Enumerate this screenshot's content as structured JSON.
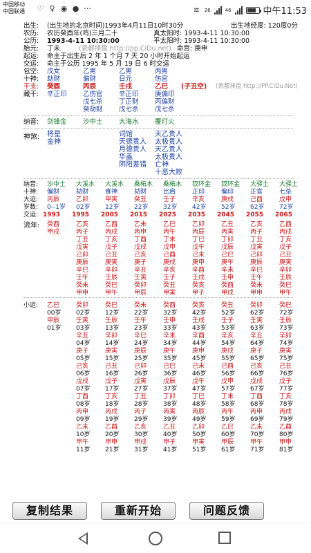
{
  "status": {
    "carrier1": "中国移动",
    "carrier2": "中国联通",
    "icons": [
      "shield-check-icon",
      "location-icon",
      "q-app-icon",
      "chat-icon",
      "more-icon"
    ],
    "network": "26",
    "network2": "46",
    "time": "中午11:53"
  },
  "header": {
    "birth_label": "出生:",
    "birth_value": "(出生地的北京时间)1993年4月11日10时30分",
    "longitude": "出生地经度: 120度0分",
    "lunar_label": "农历:",
    "lunar_value": "农历癸酉年(鸡)三月二十",
    "true_sun": "真太阳时: 1993-4-11 10:30:00",
    "gongli_label": "公历:",
    "gongli_value": "1993-4-11 10:30:00",
    "avg_sun": "平太阳时: 1993-4-11 10:30:00",
    "taiyuan_label": "胎元:",
    "taiyuan_value": "丁未",
    "watermark": "(瓷都排盘 http://pp.CiDu.net)",
    "minggong": "命宫: 庚申",
    "qiyun_label": "起运:",
    "qiyun_value": "命主于出生后 2 年 1 个月 7 天 20 小时开始起运",
    "jiaoyun_label": "交运:",
    "jiaoyun_value": "命主于公历 1995 年 5 月 19 日 6 时交运"
  },
  "pillars": {
    "baozang_label": "包空:",
    "baozang": [
      "戊女",
      "乙男",
      "乙男",
      "丙男"
    ],
    "shishen_label": "十神:",
    "shishen": [
      "劫财",
      "偏财",
      "日元",
      "伤官"
    ],
    "ganzhi_label": "干支:",
    "ganzhi": [
      "癸酉",
      "丙辰",
      "壬戌",
      "乙巳"
    ],
    "kong": "(子丑空)",
    "watermark2": "(瓷都排盘 http://PP.CiDu.Net)",
    "canggan_label": "藏干:",
    "canggan": [
      [
        "辛正印"
      ],
      [
        "乙伤官",
        "戊七杀",
        "癸劫财"
      ],
      [
        "辛正印",
        "丁正财",
        "戊七杀"
      ],
      [
        "庚偏印",
        "丙偏财",
        "戊七杀"
      ]
    ],
    "nayin_label": "纳音:",
    "nayin": [
      "剑锋金",
      "沙中土",
      "大海水",
      "覆灯火"
    ],
    "shensha_label": "神煞:",
    "shensha": [
      [
        "将星",
        "金神"
      ],
      [],
      [
        "词馆",
        "天德贵人",
        "月德贵人",
        "华盖",
        "阴阳差错"
      ],
      [
        "天乙贵人",
        "太极贵人",
        "天乙贵人",
        "太极贵人",
        "亡神",
        "十恶大败"
      ]
    ]
  },
  "dayun": {
    "nayin_label": "纳音:",
    "nayin": [
      "沙中土",
      "大溪水",
      "大溪水",
      "桑柘木",
      "桑柘木",
      "钗环金",
      "钗环金",
      "大驿土",
      "大驿土"
    ],
    "shishen_label": "十神:",
    "shishen": [
      "偏财",
      "劫财",
      "食神",
      "劫财",
      "比肩",
      "正印",
      "偏印",
      "正官",
      "七杀"
    ],
    "dayun_label": "大运:",
    "dayun": [
      "丙辰",
      "乙卯",
      "甲寅",
      "癸丑",
      "壬子",
      "辛亥",
      "庚戌",
      "己酉",
      "戊申"
    ],
    "age_label": "岁数:",
    "ages": [
      "0--1岁",
      "02岁",
      "12岁",
      "22岁",
      "32岁",
      "42岁",
      "52岁",
      "62岁",
      "72岁"
    ],
    "jiaoyun_label": "交运:",
    "years": [
      "1993",
      "1995",
      "2005",
      "2015",
      "2025",
      "2035",
      "2045",
      "2055",
      "2065"
    ],
    "liunian_label": "流年:",
    "liunian": [
      [
        "癸酉",
        "甲戌"
      ],
      [
        "乙亥",
        "丙子",
        "丁丑",
        "戊寅",
        "己卯",
        "庚辰",
        "辛巳",
        "壬午",
        "癸未",
        "甲申"
      ],
      [
        "乙酉",
        "丙戌",
        "丁亥",
        "戊子",
        "己丑",
        "庚寅",
        "辛卯",
        "壬辰",
        "癸巳",
        "甲午"
      ],
      [
        "乙未",
        "丙申",
        "丁酉",
        "戊戌",
        "己亥",
        "庚子",
        "辛丑",
        "壬寅",
        "癸卯",
        "甲辰"
      ],
      [
        "乙巳",
        "丙午",
        "丁未",
        "戊申",
        "己酉",
        "庚戌",
        "辛亥",
        "壬子",
        "癸丑",
        "甲寅"
      ],
      [
        "乙卯",
        "丙辰",
        "丁巳",
        "戊午",
        "己未",
        "庚申",
        "辛酉",
        "壬戌",
        "癸亥",
        "甲子"
      ],
      [
        "乙丑",
        "丙寅",
        "丁卯",
        "戊辰",
        "己巳",
        "庚午",
        "辛未",
        "壬申",
        "癸酉",
        "甲戌"
      ],
      [
        "乙亥",
        "丙子",
        "丁丑",
        "戊寅",
        "己卯",
        "庚辰",
        "辛巳",
        "壬午",
        "癸未",
        "甲申"
      ],
      [
        "乙酉",
        "丙戌",
        "丁亥",
        "戊子",
        "己丑",
        "庚寅",
        "辛卯",
        "壬辰",
        "癸巳",
        "甲午"
      ]
    ]
  },
  "xiaoyun": {
    "label": "小运:",
    "first": [
      "乙巳",
      "00岁",
      "甲辰",
      "01岁"
    ],
    "rows": [
      [
        "癸卯",
        "02岁",
        "壬寅",
        "03岁",
        "辛丑",
        "04岁",
        "庚子",
        "05岁",
        "己亥",
        "06岁",
        "戊戌",
        "07岁",
        "丁酉",
        "08岁",
        "丙申",
        "09岁",
        "乙未",
        "10岁",
        "甲午",
        "11岁"
      ],
      [
        "癸巳",
        "12岁",
        "壬辰",
        "13岁",
        "辛卯",
        "14岁",
        "庚寅",
        "15岁",
        "己丑",
        "16岁",
        "戊子",
        "17岁",
        "丁亥",
        "18岁",
        "丙戌",
        "19岁",
        "乙酉",
        "20岁",
        "甲申",
        "21岁"
      ],
      [
        "癸未",
        "22岁",
        "壬午",
        "23岁",
        "辛巳",
        "24岁",
        "庚辰",
        "25岁",
        "己卯",
        "26岁",
        "戊寅",
        "27岁",
        "丁丑",
        "28岁",
        "丙子",
        "29岁",
        "乙亥",
        "30岁",
        "甲戌",
        "31岁"
      ],
      [
        "癸酉",
        "32岁",
        "壬申",
        "33岁",
        "辛未",
        "34岁",
        "庚午",
        "35岁",
        "己巳",
        "36岁",
        "戊辰",
        "37岁",
        "丁卯",
        "38岁",
        "丙寅",
        "39岁",
        "乙丑",
        "40岁",
        "甲子",
        "41岁"
      ],
      [
        "癸亥",
        "42岁",
        "壬戌",
        "43岁",
        "辛酉",
        "44岁",
        "庚申",
        "45岁",
        "己未",
        "46岁",
        "戊午",
        "47岁",
        "丁巳",
        "48岁",
        "丙辰",
        "49岁",
        "乙卯",
        "50岁",
        "甲寅",
        "51岁"
      ],
      [
        "癸丑",
        "52岁",
        "壬子",
        "53岁",
        "辛亥",
        "54岁",
        "庚戌",
        "55岁",
        "己酉",
        "56岁",
        "戊申",
        "57岁",
        "丁未",
        "58岁",
        "丙午",
        "59岁",
        "乙巳",
        "60岁",
        "甲辰",
        "61岁"
      ],
      [
        "癸卯",
        "62岁",
        "壬寅",
        "63岁",
        "辛丑",
        "64岁",
        "庚子",
        "65岁",
        "己亥",
        "66岁",
        "戊戌",
        "67岁",
        "丁酉",
        "68岁",
        "丙申",
        "69岁",
        "乙未",
        "70岁",
        "甲午",
        "71岁"
      ],
      [
        "癸巳",
        "72岁",
        "壬辰",
        "73岁",
        "辛卯",
        "74岁",
        "庚寅",
        "75岁",
        "己丑",
        "76岁",
        "戊子",
        "77岁",
        "丁亥",
        "78岁",
        "丙戌",
        "79岁",
        "乙酉",
        "80岁",
        "甲申",
        "81岁"
      ]
    ]
  },
  "buttons": {
    "copy": "复制结果",
    "restart": "重新开始",
    "feedback": "问题反馈"
  }
}
